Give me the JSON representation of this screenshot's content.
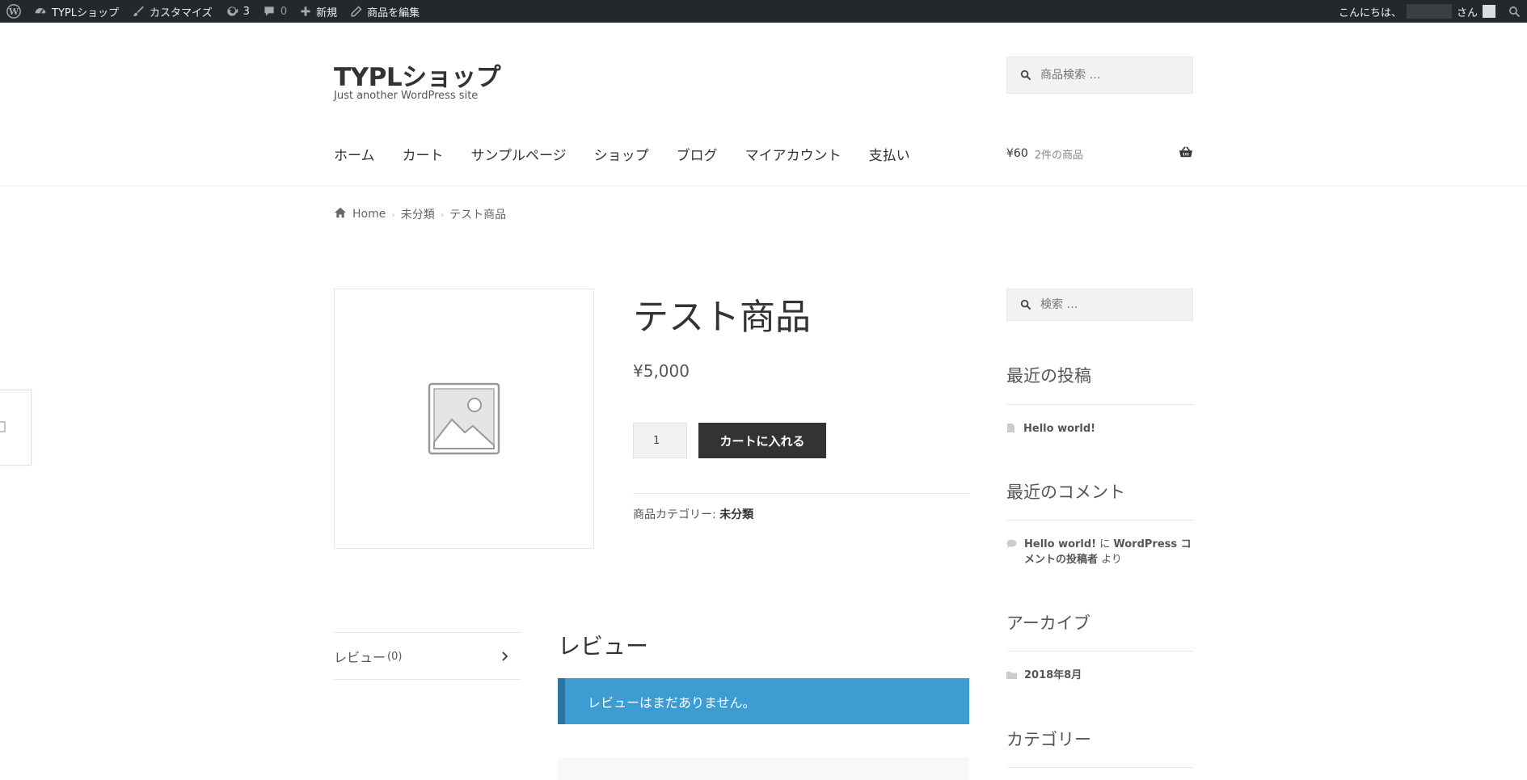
{
  "admin_bar": {
    "site_name": "TYPLショップ",
    "customize": "カスタマイズ",
    "updates_count": "3",
    "comments_count": "0",
    "new_label": "新規",
    "edit_label": "商品を編集",
    "greeting": "こんにちは、",
    "greeting_suffix": "さん"
  },
  "header": {
    "site_title": "TYPLショップ",
    "tagline": "Just another WordPress site",
    "search_placeholder": "商品検索 …",
    "nav": [
      "ホーム",
      "カート",
      "サンプルページ",
      "ショップ",
      "ブログ",
      "マイアカウント",
      "支払い"
    ],
    "cart_amount": "¥60",
    "cart_count": "2件の商品"
  },
  "breadcrumb": {
    "home": "Home",
    "category": "未分類",
    "current": "テスト商品"
  },
  "product": {
    "title": "テスト商品",
    "price": "¥5,000",
    "quantity": "1",
    "add_to_cart": "カートに入れる",
    "category_label": "商品カテゴリー: ",
    "category": "未分類"
  },
  "tabs": {
    "reviews_label": "レビュー",
    "reviews_count": "(0)"
  },
  "reviews": {
    "title": "レビュー",
    "notice": "レビューはまだありません。"
  },
  "sidebar": {
    "search_placeholder": "検索 …",
    "recent_posts_title": "最近の投稿",
    "recent_post": "Hello world!",
    "recent_comments_title": "最近のコメント",
    "comment_post": "Hello world!",
    "comment_mid": " に ",
    "comment_author": "WordPress コメントの投稿者",
    "comment_suffix": " より",
    "archives_title": "アーカイブ",
    "archive_item": "2018年8月",
    "categories_title": "カテゴリー"
  },
  "colors": {
    "admin_bar": "#23282d",
    "notice": "#3d9cd2",
    "button": "#333333"
  }
}
